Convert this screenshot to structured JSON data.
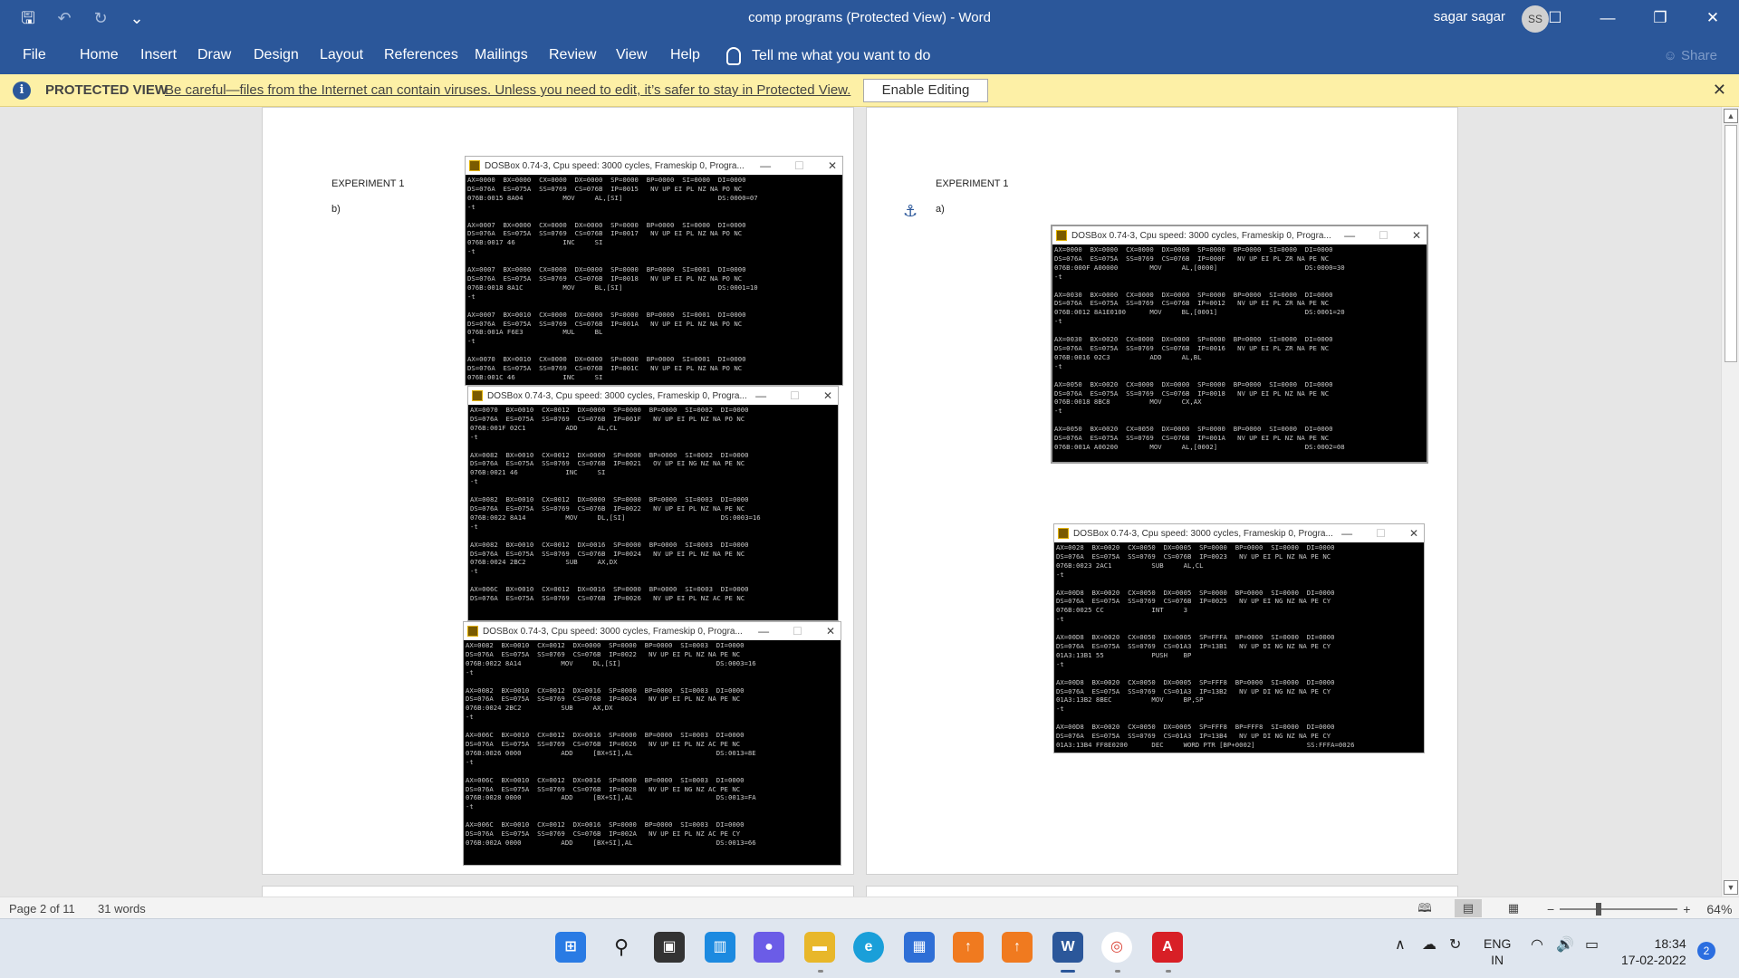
{
  "window": {
    "title": "comp programs (Protected View)  -  Word",
    "user_name": "sagar sagar",
    "avatar_initials": "SS"
  },
  "qat": {
    "save": "save-icon",
    "undo": "undo-icon",
    "redo": "redo-icon",
    "more": "⌄"
  },
  "ribbon": {
    "tabs": [
      "File",
      "Home",
      "Insert",
      "Draw",
      "Design",
      "Layout",
      "References",
      "Mailings",
      "Review",
      "View",
      "Help"
    ],
    "tell_me": "Tell me what you want to do",
    "share": "Share"
  },
  "protected_view": {
    "label": "PROTECTED VIEW",
    "message": "Be careful—files from the Internet can contain viruses. Unless you need to edit, it’s safer to stay in Protected View.",
    "enable_button": "Enable Editing"
  },
  "page_left": {
    "heading": "EXPERIMENT 1",
    "sub": "b)"
  },
  "page_right": {
    "heading": "EXPERIMENT 1",
    "sub": "a)"
  },
  "dosbox": {
    "title": "DOSBox 0.74-3, Cpu speed:     3000 cycles, Frameskip  0, Progra...",
    "windows": [
      {
        "lines": [
          "AX=0000  BX=0000  CX=0000  DX=0000  SP=0000  BP=0000  SI=0000  DI=0000",
          "DS=076A  ES=075A  SS=0769  CS=076B  IP=0015   NV UP EI PL NZ NA PO NC",
          "076B:0015 8A04          MOV     AL,[SI]                        DS:0000=07",
          "-t",
          "",
          "AX=0007  BX=0000  CX=0000  DX=0000  SP=0000  BP=0000  SI=0000  DI=0000",
          "DS=076A  ES=075A  SS=0769  CS=076B  IP=0017   NV UP EI PL NZ NA PO NC",
          "076B:0017 46            INC     SI",
          "-t",
          "",
          "AX=0007  BX=0000  CX=0000  DX=0000  SP=0000  BP=0000  SI=0001  DI=0000",
          "DS=076A  ES=075A  SS=0769  CS=076B  IP=0018   NV UP EI PL NZ NA PO NC",
          "076B:0018 8A1C          MOV     BL,[SI]                        DS:0001=10",
          "-t",
          "",
          "AX=0007  BX=0010  CX=0000  DX=0000  SP=0000  BP=0000  SI=0001  DI=0000",
          "DS=076A  ES=075A  SS=0769  CS=076B  IP=001A   NV UP EI PL NZ NA PO NC",
          "076B:001A F6E3          MUL     BL",
          "-t",
          "",
          "AX=0070  BX=0010  CX=0000  DX=0000  SP=0000  BP=0000  SI=0001  DI=0000",
          "DS=076A  ES=075A  SS=0769  CS=076B  IP=001C   NV UP EI PL NZ NA PO NC",
          "076B:001C 46            INC     SI"
        ]
      },
      {
        "lines": [
          "AX=0070  BX=0010  CX=0012  DX=0000  SP=0000  BP=0000  SI=0002  DI=0000",
          "DS=076A  ES=075A  SS=0769  CS=076B  IP=001F   NV UP EI PL NZ NA PO NC",
          "076B:001F 02C1          ADD     AL,CL",
          "-t",
          "",
          "AX=0082  BX=0010  CX=0012  DX=0000  SP=0000  BP=0000  SI=0002  DI=0000",
          "DS=076A  ES=075A  SS=0769  CS=076B  IP=0021   OV UP EI NG NZ NA PE NC",
          "076B:0021 46            INC     SI",
          "-t",
          "",
          "AX=0082  BX=0010  CX=0012  DX=0000  SP=0000  BP=0000  SI=0003  DI=0000",
          "DS=076A  ES=075A  SS=0769  CS=076B  IP=0022   NV UP EI PL NZ NA PE NC",
          "076B:0022 8A14          MOV     DL,[SI]                        DS:0003=16",
          "-t",
          "",
          "AX=0082  BX=0010  CX=0012  DX=0016  SP=0000  BP=0000  SI=0003  DI=0000",
          "DS=076A  ES=075A  SS=0769  CS=076B  IP=0024   NV UP EI PL NZ NA PE NC",
          "076B:0024 2BC2          SUB     AX,DX",
          "-t",
          "",
          "AX=006C  BX=0010  CX=0012  DX=0016  SP=0000  BP=0000  SI=0003  DI=0000",
          "DS=076A  ES=075A  SS=0769  CS=076B  IP=0026   NV UP EI PL NZ AC PE NC"
        ]
      },
      {
        "lines": [
          "AX=0082  BX=0010  CX=0012  DX=0000  SP=0000  BP=0000  SI=0003  DI=0000",
          "DS=076A  ES=075A  SS=0769  CS=076B  IP=0022   NV UP EI PL NZ NA PE NC",
          "076B:0022 8A14          MOV     DL,[SI]                        DS:0003=16",
          "-t",
          "",
          "AX=0082  BX=0010  CX=0012  DX=0016  SP=0000  BP=0000  SI=0003  DI=0000",
          "DS=076A  ES=075A  SS=0769  CS=076B  IP=0024   NV UP EI PL NZ NA PE NC",
          "076B:0024 2BC2          SUB     AX,DX",
          "-t",
          "",
          "AX=006C  BX=0010  CX=0012  DX=0016  SP=0000  BP=0000  SI=0003  DI=0000",
          "DS=076A  ES=075A  SS=0769  CS=076B  IP=0026   NV UP EI PL NZ AC PE NC",
          "076B:0026 0000          ADD     [BX+SI],AL                     DS:0013=8E",
          "-t",
          "",
          "AX=006C  BX=0010  CX=0012  DX=0016  SP=0000  BP=0000  SI=0003  DI=0000",
          "DS=076A  ES=075A  SS=0769  CS=076B  IP=0028   NV UP EI NG NZ AC PE NC",
          "076B:0028 0000          ADD     [BX+SI],AL                     DS:0013=FA",
          "-t",
          "",
          "AX=006C  BX=0010  CX=0012  DX=0016  SP=0000  BP=0000  SI=0003  DI=0000",
          "DS=076A  ES=075A  SS=0769  CS=076B  IP=002A   NV UP EI PL NZ AC PE CY",
          "076B:002A 0000          ADD     [BX+SI],AL                     DS:0013=66"
        ]
      },
      {
        "lines": [
          "AX=0000  BX=0000  CX=0000  DX=0000  SP=0000  BP=0000  SI=0000  DI=0000",
          "DS=076A  ES=075A  SS=0769  CS=076B  IP=000F   NV UP EI PL ZR NA PE NC",
          "076B:000F A00000        MOV     AL,[0000]                      DS:0000=30",
          "-t",
          "",
          "AX=0030  BX=0000  CX=0000  DX=0000  SP=0000  BP=0000  SI=0000  DI=0000",
          "DS=076A  ES=075A  SS=0769  CS=076B  IP=0012   NV UP EI PL ZR NA PE NC",
          "076B:0012 8A1E0100      MOV     BL,[0001]                      DS:0001=20",
          "-t",
          "",
          "AX=0030  BX=0020  CX=0000  DX=0000  SP=0000  BP=0000  SI=0000  DI=0000",
          "DS=076A  ES=075A  SS=0769  CS=076B  IP=0016   NV UP EI PL ZR NA PE NC",
          "076B:0016 02C3          ADD     AL,BL",
          "-t",
          "",
          "AX=0050  BX=0020  CX=0000  DX=0000  SP=0000  BP=0000  SI=0000  DI=0000",
          "DS=076A  ES=075A  SS=0769  CS=076B  IP=0018   NV UP EI PL NZ NA PE NC",
          "076B:0018 8BC8          MOV     CX,AX",
          "-t",
          "",
          "AX=0050  BX=0020  CX=0050  DX=0000  SP=0000  BP=0000  SI=0000  DI=0000",
          "DS=076A  ES=075A  SS=0769  CS=076B  IP=001A   NV UP EI PL NZ NA PE NC",
          "076B:001A A00200        MOV     AL,[0002]                      DS:0002=08"
        ]
      },
      {
        "lines": [
          "AX=0028  BX=0020  CX=0050  DX=0005  SP=0000  BP=0000  SI=0000  DI=0000",
          "DS=076A  ES=075A  SS=0769  CS=076B  IP=0023   NV UP EI PL NZ NA PE NC",
          "076B:0023 2AC1          SUB     AL,CL",
          "-t",
          "",
          "AX=00D8  BX=0020  CX=0050  DX=0005  SP=0000  BP=0000  SI=0000  DI=0000",
          "DS=076A  ES=075A  SS=0769  CS=076B  IP=0025   NV UP EI NG NZ NA PE CY",
          "076B:0025 CC            INT     3",
          "-t",
          "",
          "AX=00D8  BX=0020  CX=0050  DX=0005  SP=FFFA  BP=0000  SI=0000  DI=0000",
          "DS=076A  ES=075A  SS=0769  CS=01A3  IP=13B1   NV UP DI NG NZ NA PE CY",
          "01A3:13B1 55            PUSH    BP",
          "-t",
          "",
          "AX=00D8  BX=0020  CX=0050  DX=0005  SP=FFF8  BP=0000  SI=0000  DI=0000",
          "DS=076A  ES=075A  SS=0769  CS=01A3  IP=13B2   NV UP DI NG NZ NA PE CY",
          "01A3:13B2 8BEC          MOV     BP,SP",
          "-t",
          "",
          "AX=00D8  BX=0020  CX=0050  DX=0005  SP=FFF8  BP=FFF8  SI=0000  DI=0000",
          "DS=076A  ES=075A  SS=0769  CS=01A3  IP=13B4   NV UP DI NG NZ NA PE CY",
          "01A3:13B4 FF8E0200      DEC     WORD PTR [BP+0002]             SS:FFFA=0026"
        ]
      }
    ]
  },
  "status": {
    "page": "Page 2 of 11",
    "words": "31 words",
    "zoom": "64%",
    "zoom_level_percent": 64
  },
  "taskbar": {
    "lang_top": "ENG",
    "lang_bottom": "IN",
    "time": "18:34",
    "date": "17-02-2022",
    "notifications": "2"
  },
  "colors": {
    "word_blue": "#2b579a",
    "protected_bar": "#fdf0a6",
    "dos_text": "#c8c8c8"
  }
}
